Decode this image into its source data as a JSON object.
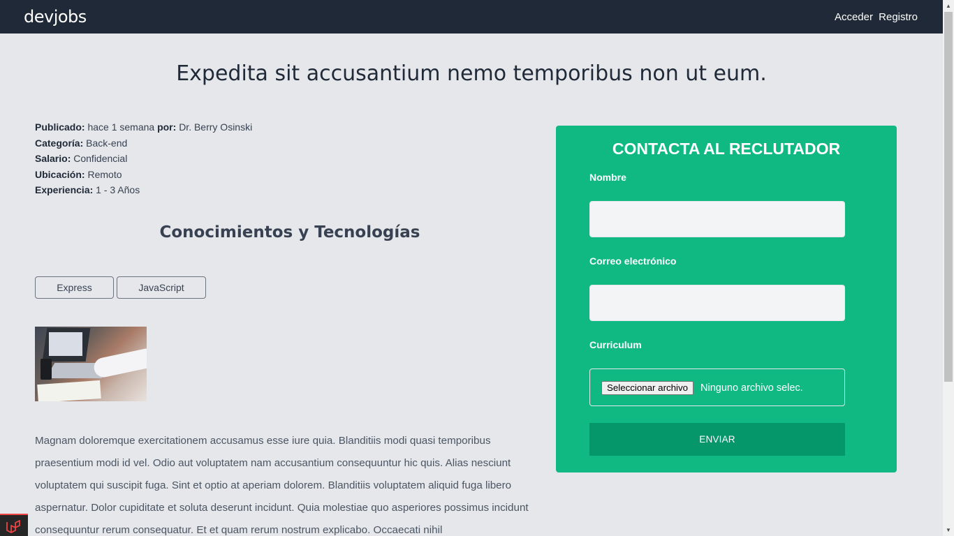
{
  "navbar": {
    "brand": "devjobs",
    "login_label": "Acceder",
    "register_label": "Registro"
  },
  "job": {
    "title": "Expedita sit accusantium nemo temporibus non ut eum.",
    "published_label": "Publicado:",
    "published_value": "hace 1 semana",
    "by_label": "por:",
    "author": "Dr. Berry Osinski",
    "category_label": "Categoría:",
    "category_value": "Back-end",
    "salary_label": "Salario:",
    "salary_value": "Confidencial",
    "location_label": "Ubicación:",
    "location_value": "Remoto",
    "experience_label": "Experiencia:",
    "experience_value": "1 - 3 Años",
    "skills_title": "Conocimientos y Tecnologías",
    "skills": [
      "Express",
      "JavaScript"
    ],
    "description": "Magnam doloremque exercitationem accusamus esse iure quia. Blanditiis modi quasi temporibus praesentium modi id vel. Odio aut voluptatem nam accusantium consequuntur hic quis. Alias nesciunt voluptatem qui suscipit fuga. Sint et optio at aperiam dolorem. Blanditiis voluptatem aliquid fuga libero aspernatur. Dolor cupiditate et soluta deserunt incidunt. Quia molestiae quo asperiores possimus incidunt consequuntur rerum consequatur. Et et quam rerum nostrum explicabo. Occaecati nihil"
  },
  "contact": {
    "title": "CONTACTA AL RECLUTADOR",
    "name_label": "Nombre",
    "name_value": "",
    "email_label": "Correo electrónico",
    "email_value": "",
    "cv_label": "Curriculum",
    "file_button": "Seleccionar archivo",
    "file_status": "Ninguno archivo selec.",
    "submit_label": "ENVIAR"
  },
  "colors": {
    "navbar": "#1f2937",
    "background": "#e5e7eb",
    "contact_card": "#10b981",
    "submit_button": "#059669"
  }
}
